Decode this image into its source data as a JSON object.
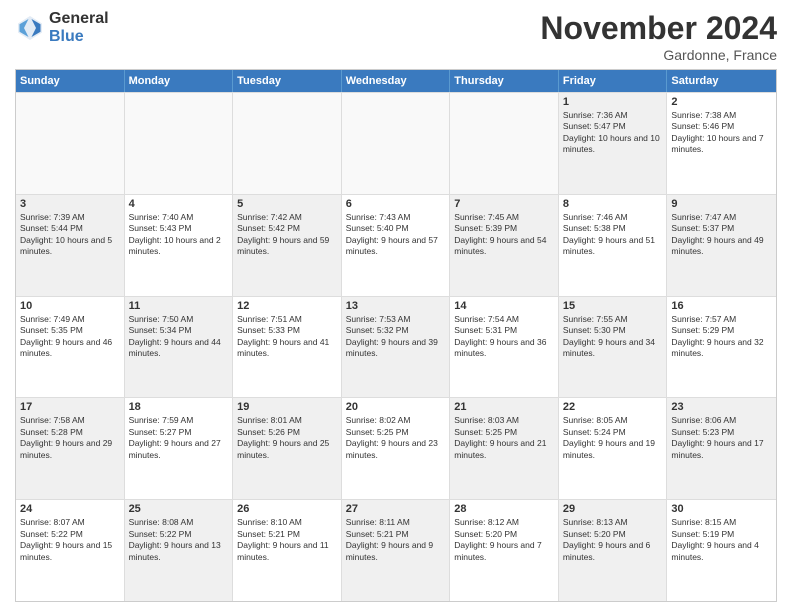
{
  "logo": {
    "general": "General",
    "blue": "Blue"
  },
  "header": {
    "month": "November 2024",
    "location": "Gardonne, France"
  },
  "weekdays": [
    "Sunday",
    "Monday",
    "Tuesday",
    "Wednesday",
    "Thursday",
    "Friday",
    "Saturday"
  ],
  "rows": [
    [
      {
        "day": "",
        "info": "",
        "empty": true
      },
      {
        "day": "",
        "info": "",
        "empty": true
      },
      {
        "day": "",
        "info": "",
        "empty": true
      },
      {
        "day": "",
        "info": "",
        "empty": true
      },
      {
        "day": "",
        "info": "",
        "empty": true
      },
      {
        "day": "1",
        "info": "Sunrise: 7:36 AM\nSunset: 5:47 PM\nDaylight: 10 hours and 10 minutes.",
        "empty": false,
        "shaded": true
      },
      {
        "day": "2",
        "info": "Sunrise: 7:38 AM\nSunset: 5:46 PM\nDaylight: 10 hours and 7 minutes.",
        "empty": false,
        "shaded": false
      }
    ],
    [
      {
        "day": "3",
        "info": "Sunrise: 7:39 AM\nSunset: 5:44 PM\nDaylight: 10 hours and 5 minutes.",
        "empty": false,
        "shaded": true
      },
      {
        "day": "4",
        "info": "Sunrise: 7:40 AM\nSunset: 5:43 PM\nDaylight: 10 hours and 2 minutes.",
        "empty": false,
        "shaded": false
      },
      {
        "day": "5",
        "info": "Sunrise: 7:42 AM\nSunset: 5:42 PM\nDaylight: 9 hours and 59 minutes.",
        "empty": false,
        "shaded": true
      },
      {
        "day": "6",
        "info": "Sunrise: 7:43 AM\nSunset: 5:40 PM\nDaylight: 9 hours and 57 minutes.",
        "empty": false,
        "shaded": false
      },
      {
        "day": "7",
        "info": "Sunrise: 7:45 AM\nSunset: 5:39 PM\nDaylight: 9 hours and 54 minutes.",
        "empty": false,
        "shaded": true
      },
      {
        "day": "8",
        "info": "Sunrise: 7:46 AM\nSunset: 5:38 PM\nDaylight: 9 hours and 51 minutes.",
        "empty": false,
        "shaded": false
      },
      {
        "day": "9",
        "info": "Sunrise: 7:47 AM\nSunset: 5:37 PM\nDaylight: 9 hours and 49 minutes.",
        "empty": false,
        "shaded": true
      }
    ],
    [
      {
        "day": "10",
        "info": "Sunrise: 7:49 AM\nSunset: 5:35 PM\nDaylight: 9 hours and 46 minutes.",
        "empty": false,
        "shaded": false
      },
      {
        "day": "11",
        "info": "Sunrise: 7:50 AM\nSunset: 5:34 PM\nDaylight: 9 hours and 44 minutes.",
        "empty": false,
        "shaded": true
      },
      {
        "day": "12",
        "info": "Sunrise: 7:51 AM\nSunset: 5:33 PM\nDaylight: 9 hours and 41 minutes.",
        "empty": false,
        "shaded": false
      },
      {
        "day": "13",
        "info": "Sunrise: 7:53 AM\nSunset: 5:32 PM\nDaylight: 9 hours and 39 minutes.",
        "empty": false,
        "shaded": true
      },
      {
        "day": "14",
        "info": "Sunrise: 7:54 AM\nSunset: 5:31 PM\nDaylight: 9 hours and 36 minutes.",
        "empty": false,
        "shaded": false
      },
      {
        "day": "15",
        "info": "Sunrise: 7:55 AM\nSunset: 5:30 PM\nDaylight: 9 hours and 34 minutes.",
        "empty": false,
        "shaded": true
      },
      {
        "day": "16",
        "info": "Sunrise: 7:57 AM\nSunset: 5:29 PM\nDaylight: 9 hours and 32 minutes.",
        "empty": false,
        "shaded": false
      }
    ],
    [
      {
        "day": "17",
        "info": "Sunrise: 7:58 AM\nSunset: 5:28 PM\nDaylight: 9 hours and 29 minutes.",
        "empty": false,
        "shaded": true
      },
      {
        "day": "18",
        "info": "Sunrise: 7:59 AM\nSunset: 5:27 PM\nDaylight: 9 hours and 27 minutes.",
        "empty": false,
        "shaded": false
      },
      {
        "day": "19",
        "info": "Sunrise: 8:01 AM\nSunset: 5:26 PM\nDaylight: 9 hours and 25 minutes.",
        "empty": false,
        "shaded": true
      },
      {
        "day": "20",
        "info": "Sunrise: 8:02 AM\nSunset: 5:25 PM\nDaylight: 9 hours and 23 minutes.",
        "empty": false,
        "shaded": false
      },
      {
        "day": "21",
        "info": "Sunrise: 8:03 AM\nSunset: 5:25 PM\nDaylight: 9 hours and 21 minutes.",
        "empty": false,
        "shaded": true
      },
      {
        "day": "22",
        "info": "Sunrise: 8:05 AM\nSunset: 5:24 PM\nDaylight: 9 hours and 19 minutes.",
        "empty": false,
        "shaded": false
      },
      {
        "day": "23",
        "info": "Sunrise: 8:06 AM\nSunset: 5:23 PM\nDaylight: 9 hours and 17 minutes.",
        "empty": false,
        "shaded": true
      }
    ],
    [
      {
        "day": "24",
        "info": "Sunrise: 8:07 AM\nSunset: 5:22 PM\nDaylight: 9 hours and 15 minutes.",
        "empty": false,
        "shaded": false
      },
      {
        "day": "25",
        "info": "Sunrise: 8:08 AM\nSunset: 5:22 PM\nDaylight: 9 hours and 13 minutes.",
        "empty": false,
        "shaded": true
      },
      {
        "day": "26",
        "info": "Sunrise: 8:10 AM\nSunset: 5:21 PM\nDaylight: 9 hours and 11 minutes.",
        "empty": false,
        "shaded": false
      },
      {
        "day": "27",
        "info": "Sunrise: 8:11 AM\nSunset: 5:21 PM\nDaylight: 9 hours and 9 minutes.",
        "empty": false,
        "shaded": true
      },
      {
        "day": "28",
        "info": "Sunrise: 8:12 AM\nSunset: 5:20 PM\nDaylight: 9 hours and 7 minutes.",
        "empty": false,
        "shaded": false
      },
      {
        "day": "29",
        "info": "Sunrise: 8:13 AM\nSunset: 5:20 PM\nDaylight: 9 hours and 6 minutes.",
        "empty": false,
        "shaded": true
      },
      {
        "day": "30",
        "info": "Sunrise: 8:15 AM\nSunset: 5:19 PM\nDaylight: 9 hours and 4 minutes.",
        "empty": false,
        "shaded": false
      }
    ]
  ]
}
